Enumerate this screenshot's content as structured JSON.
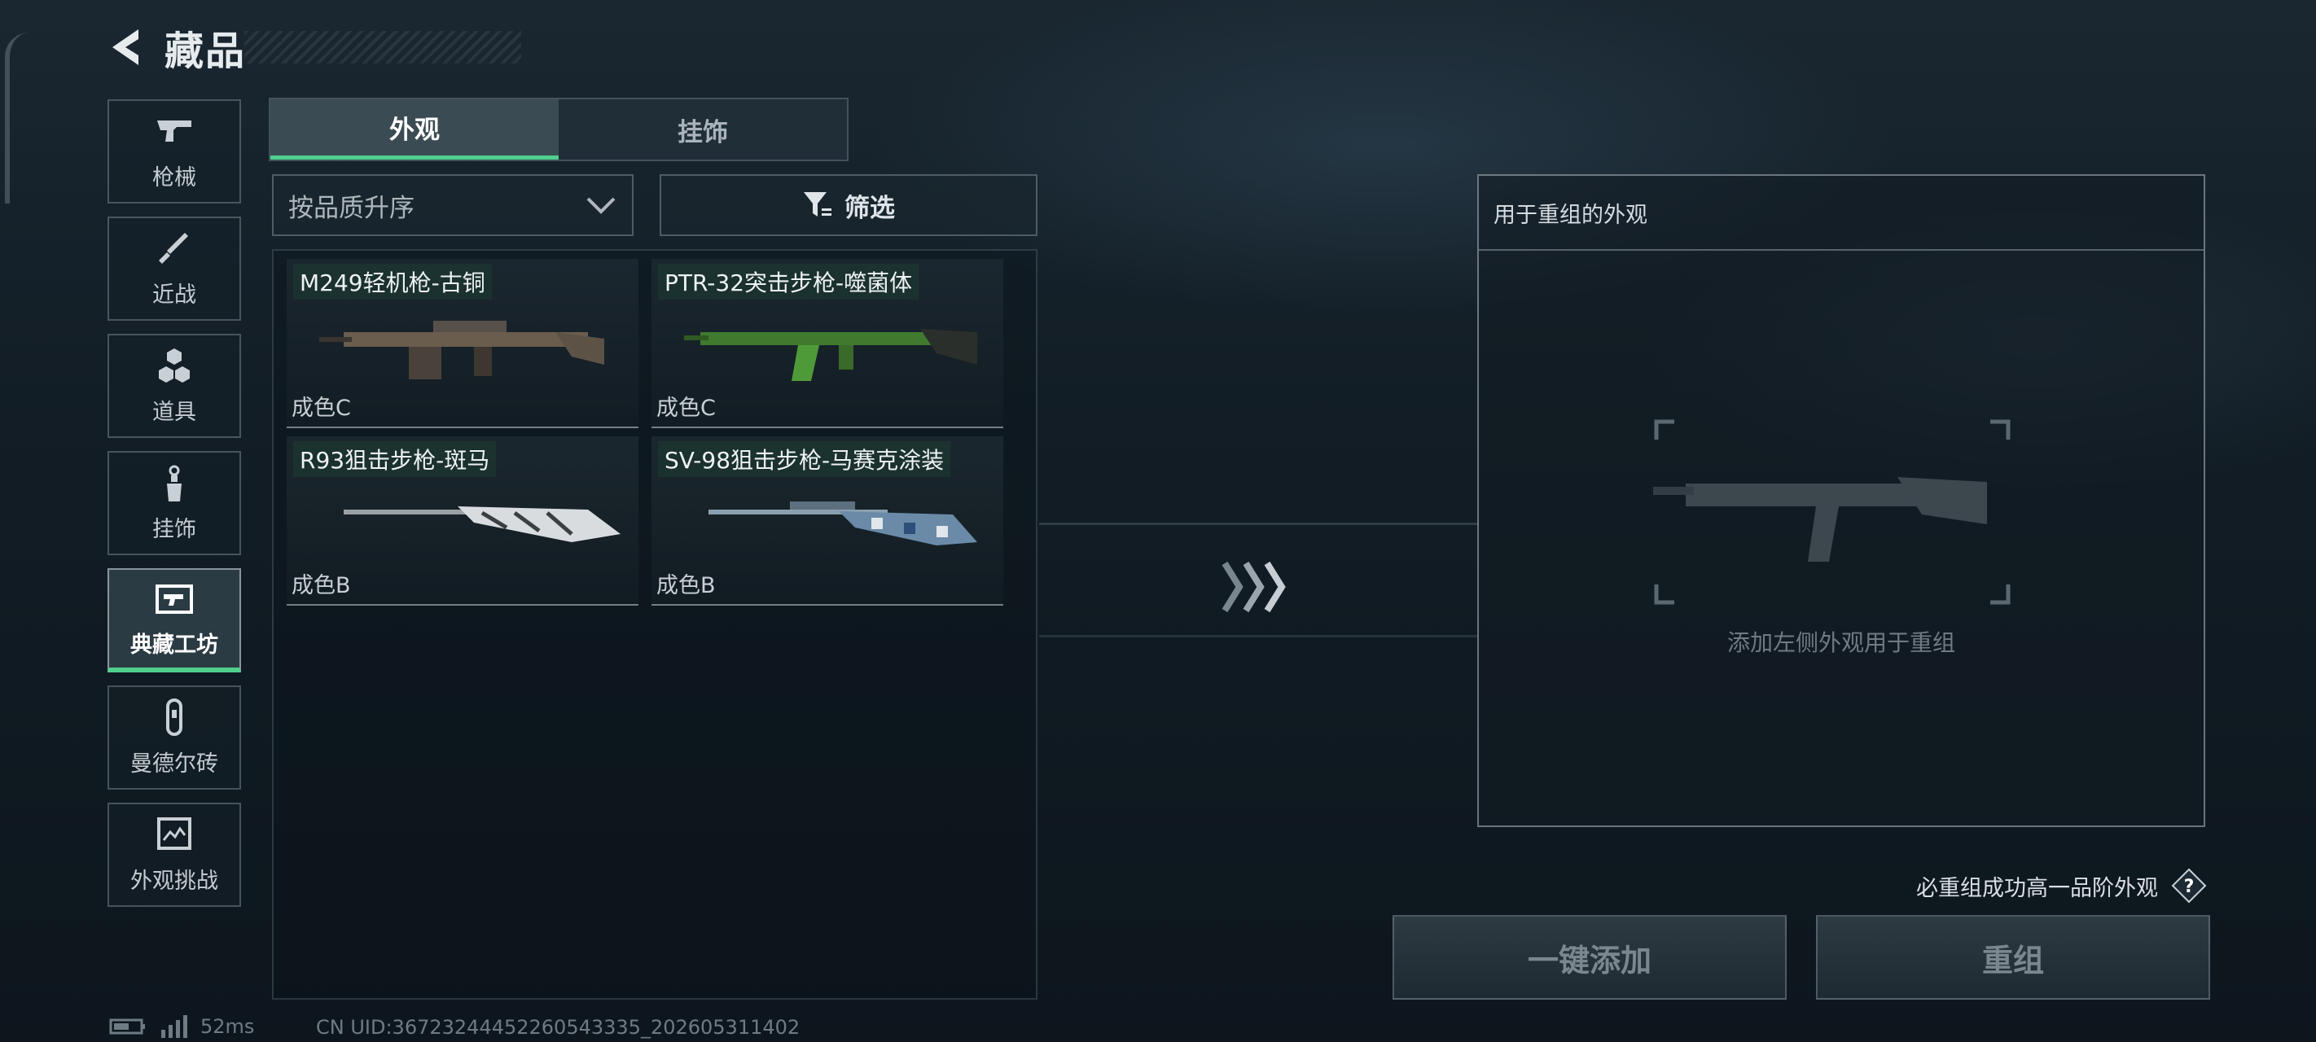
{
  "header": {
    "title": "藏品"
  },
  "sidebar": {
    "items": [
      {
        "label": "枪械",
        "icon": "pistol-icon"
      },
      {
        "label": "近战",
        "icon": "knife-icon"
      },
      {
        "label": "道具",
        "icon": "grenade-icon"
      },
      {
        "label": "挂饰",
        "icon": "charm-icon"
      },
      {
        "label": "典藏工坊",
        "icon": "workshop-icon",
        "active": true
      },
      {
        "label": "曼德尔砖",
        "icon": "brick-icon"
      },
      {
        "label": "外观挑战",
        "icon": "challenge-icon"
      }
    ]
  },
  "tabs": [
    {
      "label": "外观",
      "active": true
    },
    {
      "label": "挂饰",
      "active": false
    }
  ],
  "sort": {
    "value": "按品质升序"
  },
  "filter": {
    "label": "筛选"
  },
  "skins": [
    {
      "name": "M249轻机枪-古铜",
      "grade": "成色C"
    },
    {
      "name": "PTR-32突击步枪-噬菌体",
      "grade": "成色C"
    },
    {
      "name": "R93狙击步枪-斑马",
      "grade": "成色B"
    },
    {
      "name": "SV-98狙击步枪-马赛克涂装",
      "grade": "成色B"
    }
  ],
  "recombine": {
    "title": "用于重组的外观",
    "hint": "添加左侧外观用于重组"
  },
  "guarantee": {
    "text": "必重组成功高一品阶外观",
    "help": "?"
  },
  "buttons": {
    "quick_add": "一键添加",
    "recombine": "重组"
  },
  "status": {
    "ping": "52ms",
    "uid": "CN UID:36723244452260543335_202605311402"
  },
  "colors": {
    "accent": "#4ecf8e",
    "background": "#121d25"
  }
}
